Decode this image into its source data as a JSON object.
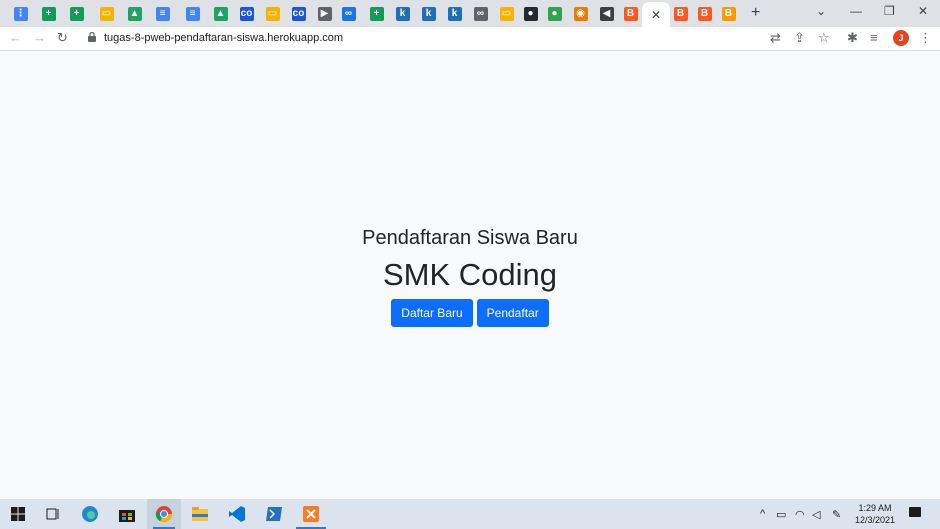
{
  "browser": {
    "url": "tugas-8-pweb-pendaftaran-siswa.herokuapp.com",
    "active_tab_close": "✕",
    "new_tab": "+",
    "profile_initial": "J",
    "tabs": [
      {
        "icon": "hierarchy-icon",
        "color": "#4285f4",
        "glyph": "⋮"
      },
      {
        "icon": "sheets-icon",
        "color": "#0f9d58",
        "glyph": "+"
      },
      {
        "icon": "sheets-icon",
        "color": "#0f9d58",
        "glyph": "+"
      },
      {
        "icon": "slides-icon",
        "color": "#f4b400",
        "glyph": "▭"
      },
      {
        "icon": "drive-icon",
        "color": "#1ea362",
        "glyph": "▲"
      },
      {
        "icon": "docs-icon",
        "color": "#4285f4",
        "glyph": "≡"
      },
      {
        "icon": "docs-icon",
        "color": "#4285f4",
        "glyph": "≡"
      },
      {
        "icon": "drive-icon",
        "color": "#1ea362",
        "glyph": "▲"
      },
      {
        "icon": "colab-icon",
        "color": "#1a56db",
        "glyph": "co"
      },
      {
        "icon": "slides-icon",
        "color": "#f4b400",
        "glyph": "▭"
      },
      {
        "icon": "colab-icon",
        "color": "#1a56db",
        "glyph": "co"
      },
      {
        "icon": "play-icon",
        "color": "#5f6368",
        "glyph": "▶"
      },
      {
        "icon": "infinity-icon",
        "color": "#1a73e8",
        "glyph": "∞"
      },
      {
        "icon": "sheets-icon",
        "color": "#0f9d58",
        "glyph": "+"
      },
      {
        "icon": "k-icon",
        "color": "#1e6fb8",
        "glyph": "k"
      },
      {
        "icon": "k-icon",
        "color": "#1e6fb8",
        "glyph": "k"
      },
      {
        "icon": "k-icon",
        "color": "#1e6fb8",
        "glyph": "k"
      },
      {
        "icon": "link-icon",
        "color": "#5f6368",
        "glyph": "∞"
      },
      {
        "icon": "slides-icon",
        "color": "#f4b400",
        "glyph": "▭"
      },
      {
        "icon": "github-icon",
        "color": "#24292f",
        "glyph": "●"
      },
      {
        "icon": "github-icon",
        "color": "#2ea44f",
        "glyph": "●"
      },
      {
        "icon": "blender-icon",
        "color": "#e87d0d",
        "glyph": "◉"
      },
      {
        "icon": "audio-icon",
        "color": "#3c4043",
        "glyph": "◀"
      },
      {
        "icon": "blogger-icon",
        "color": "#ff5722",
        "glyph": "B"
      },
      {
        "icon": "blogger-icon",
        "color": "#ff5722",
        "glyph": "B"
      },
      {
        "icon": "blogger-icon",
        "color": "#ff5722",
        "glyph": "B"
      },
      {
        "icon": "blogger-icon",
        "color": "#ff9800",
        "glyph": "B"
      }
    ]
  },
  "page": {
    "subtitle": "Pendaftaran Siswa Baru",
    "title": "SMK Coding",
    "buttons": {
      "register": "Daftar Baru",
      "registrants": "Pendaftar"
    },
    "button_color": "#0d6efd"
  },
  "taskbar": {
    "time": "1:29 AM",
    "date": "12/3/2021",
    "apps": [
      "windows-start-icon",
      "task-view-icon",
      "edge-icon",
      "store-icon",
      "chrome-icon",
      "file-explorer-icon",
      "vscode-icon",
      "powershell-icon",
      "xampp-icon"
    ]
  }
}
